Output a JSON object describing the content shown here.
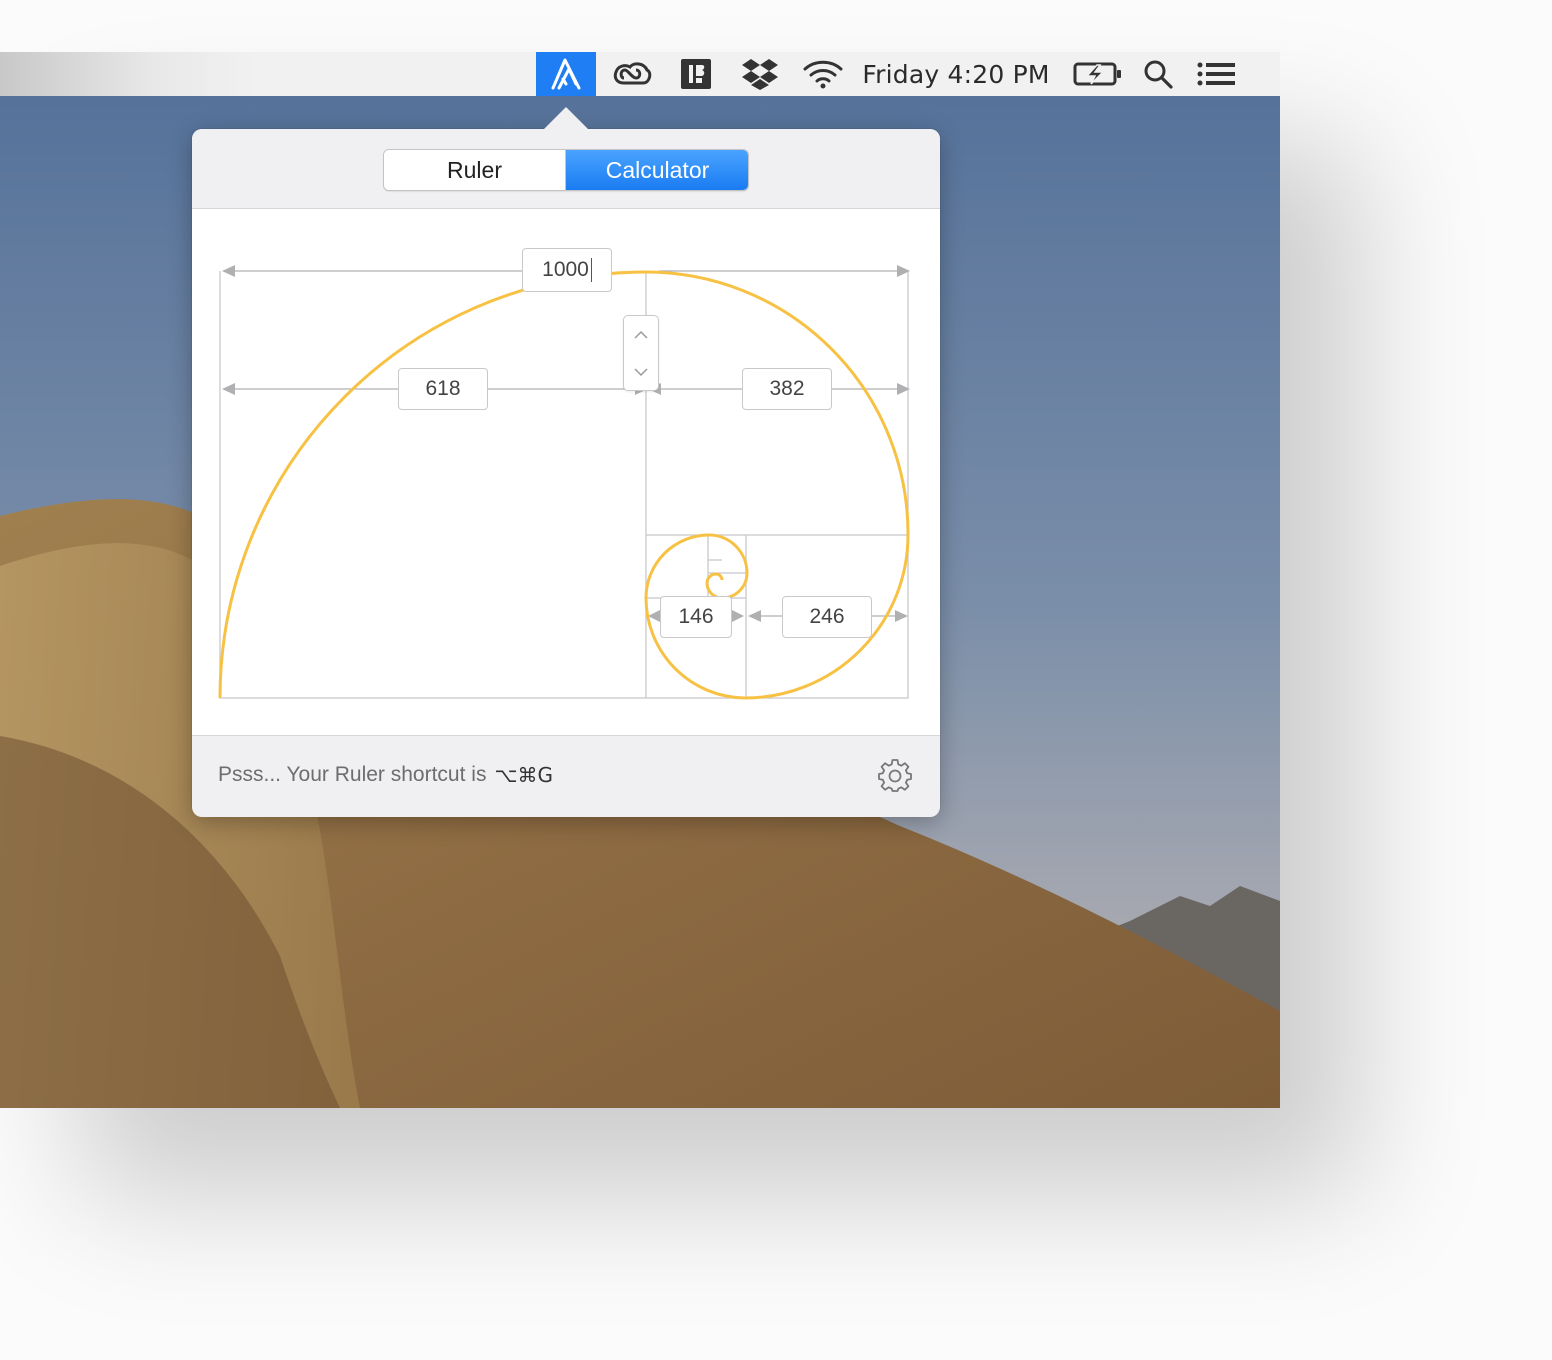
{
  "menubar": {
    "clock": "Friday 4:20 PM",
    "icons": [
      "ruler-app-icon",
      "creative-cloud-icon",
      "dash-icon",
      "dropbox-icon",
      "wifi-icon",
      "battery-charging-icon",
      "spotlight-search-icon",
      "notification-center-icon"
    ],
    "accent_color": "#1f7ef3"
  },
  "popover": {
    "tabs": {
      "ruler": "Ruler",
      "calculator": "Calculator",
      "active": "Calculator"
    },
    "calculator": {
      "input_value": "1000",
      "large": "618",
      "small": "382",
      "smaller": "246",
      "smallest": "146"
    },
    "footer": {
      "hint_text": "Psss... Your Ruler shortcut is",
      "shortcut": "⌥⌘G"
    },
    "spiral_color": "#f7c244"
  }
}
